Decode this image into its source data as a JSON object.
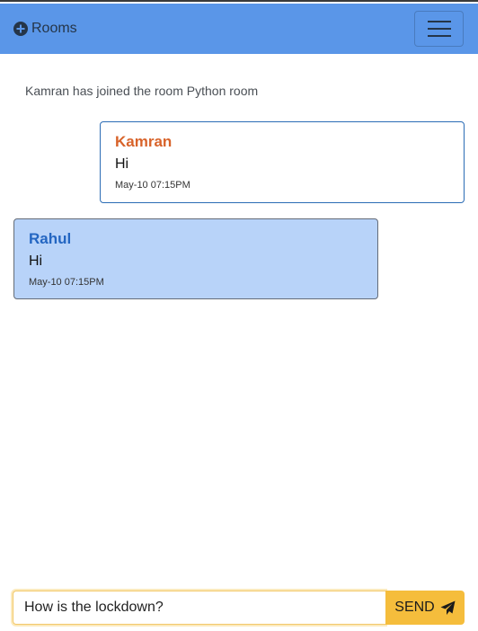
{
  "navbar": {
    "rooms_label": "Rooms",
    "rooms_icon": "plus-circle-icon",
    "menu_icon": "hamburger-menu-icon",
    "background": "#5a96e8"
  },
  "system_message": "Kamran has joined the room Python room",
  "messages": [
    {
      "sender": "Kamran",
      "text": "Hi",
      "time": "May-10 07:15PM",
      "self": true,
      "sender_color": "#d8632a"
    },
    {
      "sender": "Rahul",
      "text": "Hi",
      "time": "May-10 07:15PM",
      "self": false,
      "sender_color": "#2466c2",
      "bubble_color": "#b8d3f9"
    }
  ],
  "composer": {
    "input_value": "How is the lockdown?",
    "send_label": "SEND",
    "send_icon": "paper-plane-icon",
    "send_color": "#f5bd3c"
  }
}
